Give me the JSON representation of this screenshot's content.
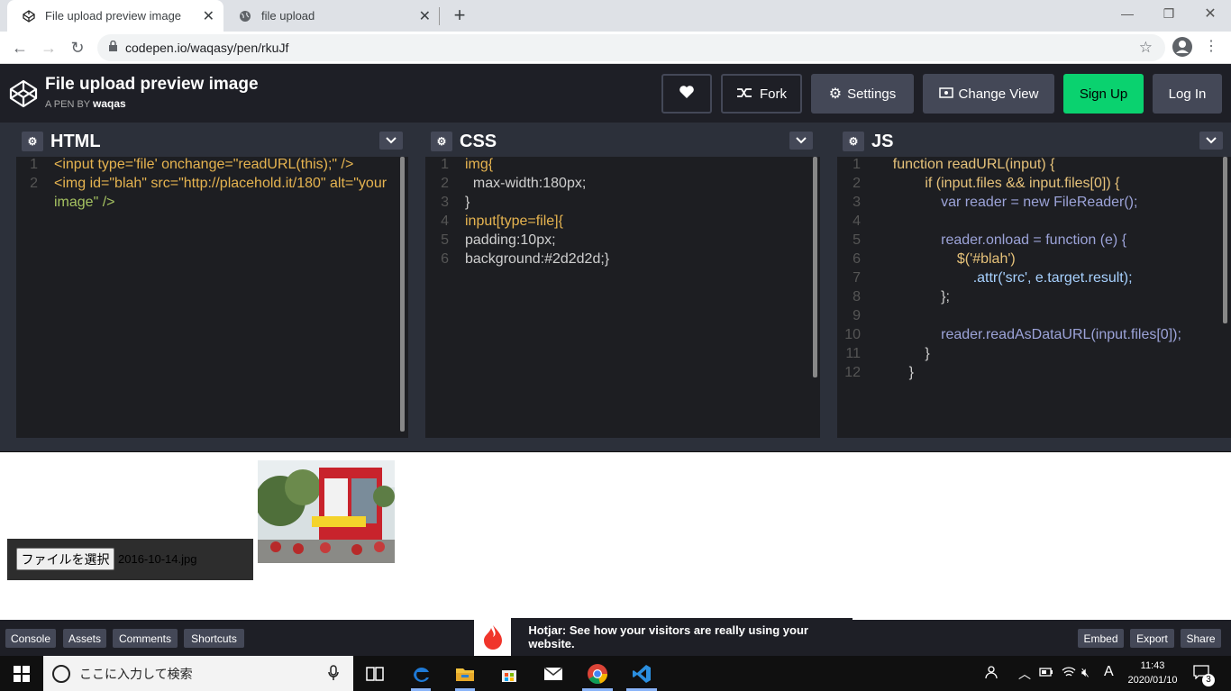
{
  "browser": {
    "tabs": [
      {
        "title": "File upload preview image",
        "active": true
      },
      {
        "title": "file upload",
        "active": false
      }
    ],
    "url": "codepen.io/waqasy/pen/rkuJf"
  },
  "codepen": {
    "title": "File upload preview image",
    "byline_prefix": "A PEN BY",
    "author": "waqas",
    "buttons": {
      "fork": "Fork",
      "settings": "Settings",
      "change_view": "Change View",
      "sign_up": "Sign Up",
      "log_in": "Log In"
    },
    "colors": {
      "sign_up": "#0ebeff",
      "accent_green": "#0ad26f"
    }
  },
  "editors": {
    "html": {
      "title": "HTML",
      "line_numbers": [
        "1",
        "2"
      ],
      "lines": [
        "<input type='file' onchange=\"readURL(this);\" />",
        "<img id=\"blah\" src=\"http://placehold.it/180\" alt=\"your",
        "image\" />"
      ]
    },
    "css": {
      "title": "CSS",
      "line_numbers": [
        "1",
        "2",
        "3",
        "4",
        "5",
        "6"
      ],
      "lines": [
        "img{",
        "  max-width:180px;",
        "}",
        "input[type=file]{",
        "padding:10px;",
        "background:#2d2d2d;}"
      ]
    },
    "js": {
      "title": "JS",
      "line_numbers": [
        "1",
        "2",
        "3",
        "4",
        "5",
        "6",
        "7",
        "8",
        "9",
        "10",
        "11",
        "12"
      ],
      "lines": [
        "    function readURL(input) {",
        "            if (input.files && input.files[0]) {",
        "                var reader = new FileReader();",
        "",
        "                reader.onload = function (e) {",
        "                    $('#blah')",
        "                        .attr('src', e.target.result);",
        "                };",
        "",
        "                reader.readAsDataURL(input.files[0]);",
        "            }",
        "        }"
      ]
    }
  },
  "preview": {
    "file_button": "ファイルを選択",
    "file_name": "2016-10-14.jpg"
  },
  "bottom": {
    "left_buttons": [
      "Console",
      "Assets",
      "Comments",
      "Shortcuts"
    ],
    "right_buttons": [
      "Embed",
      "Export",
      "Share"
    ],
    "hotjar_text": "Hotjar: See how your visitors are really using your website."
  },
  "taskbar": {
    "search_placeholder": "ここに入力して検索",
    "time": "11:43",
    "date": "2020/01/10",
    "ime": "A",
    "notifications": "3"
  }
}
